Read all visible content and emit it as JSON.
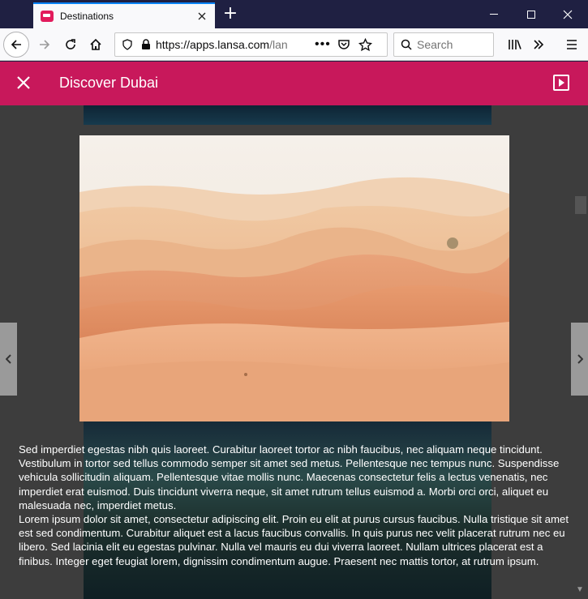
{
  "browser": {
    "tab_title": "Destinations",
    "url_text": "https://apps.",
    "url_domain": "lansa.com",
    "url_rest": "/lan",
    "search_placeholder": "Search"
  },
  "app": {
    "title": "Discover Dubai"
  },
  "content": {
    "paragraphs": [
      "Sed imperdiet egestas nibh quis laoreet. Curabitur laoreet tortor ac nibh faucibus, nec aliquam neque tincidunt. Vestibulum in tortor sed tellus commodo semper sit amet sed metus. Pellentesque nec tempus nunc. Suspendisse vehicula sollicitudin aliquam. Pellentesque vitae mollis nunc. Maecenas consectetur felis a lectus venenatis, nec imperdiet erat euismod. Duis tincidunt viverra neque, sit amet rutrum tellus euismod a. Morbi orci orci, aliquet eu malesuada nec, imperdiet metus.",
      "Lorem ipsum dolor sit amet, consectetur adipiscing elit. Proin eu elit at purus cursus faucibus. Nulla tristique sit amet est sed condimentum. Curabitur aliquet est a lacus faucibus convallis. In quis purus nec velit placerat rutrum nec eu libero. Sed lacinia elit eu egestas pulvinar. Nulla vel mauris eu dui viverra laoreet. Nullam ultrices placerat est a finibus. Integer eget feugiat lorem, dignissim condimentum augue. Praesent nec mattis tortor, at rutrum ipsum."
    ]
  },
  "colors": {
    "brand": "#c8185b",
    "titlebar": "#1f2042",
    "content_bg": "#3d3d3d"
  }
}
